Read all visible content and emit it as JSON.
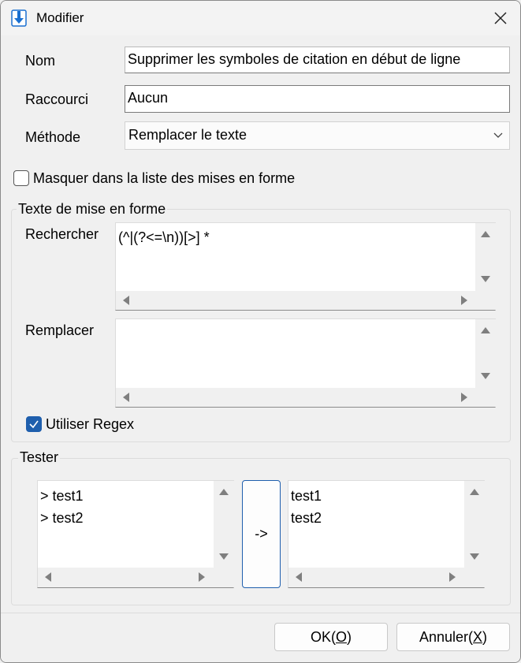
{
  "window": {
    "title": "Modifier",
    "icon": "download-arrow-icon"
  },
  "form": {
    "name_label": "Nom",
    "name_value": "Supprimer les symboles de citation en début de ligne",
    "shortcut_label": "Raccourci",
    "shortcut_value": "Aucun",
    "method_label": "Méthode",
    "method_value": "Remplacer le texte",
    "hide_checkbox_label": "Masquer dans la liste des mises en forme",
    "hide_checked": false
  },
  "formatting_group": {
    "title": "Texte de mise en forme",
    "search_label": "Rechercher",
    "search_value": "(^|(?<=\\n))[>] *",
    "replace_label": "Remplacer",
    "replace_value": "",
    "regex_label": "Utiliser Regex",
    "regex_checked": true
  },
  "tester_group": {
    "title": "Tester",
    "input_lines": [
      "> test1",
      "> test2"
    ],
    "run_button_label": "->",
    "output_lines": [
      "test1",
      "test2"
    ]
  },
  "footer": {
    "ok_label": "OK(",
    "ok_mnemonic": "O",
    "ok_suffix": ")",
    "cancel_label": "Annuler(",
    "cancel_mnemonic": "X",
    "cancel_suffix": ")"
  },
  "colors": {
    "accent": "#1f5fad",
    "icon_blue": "#1a6fd0"
  }
}
